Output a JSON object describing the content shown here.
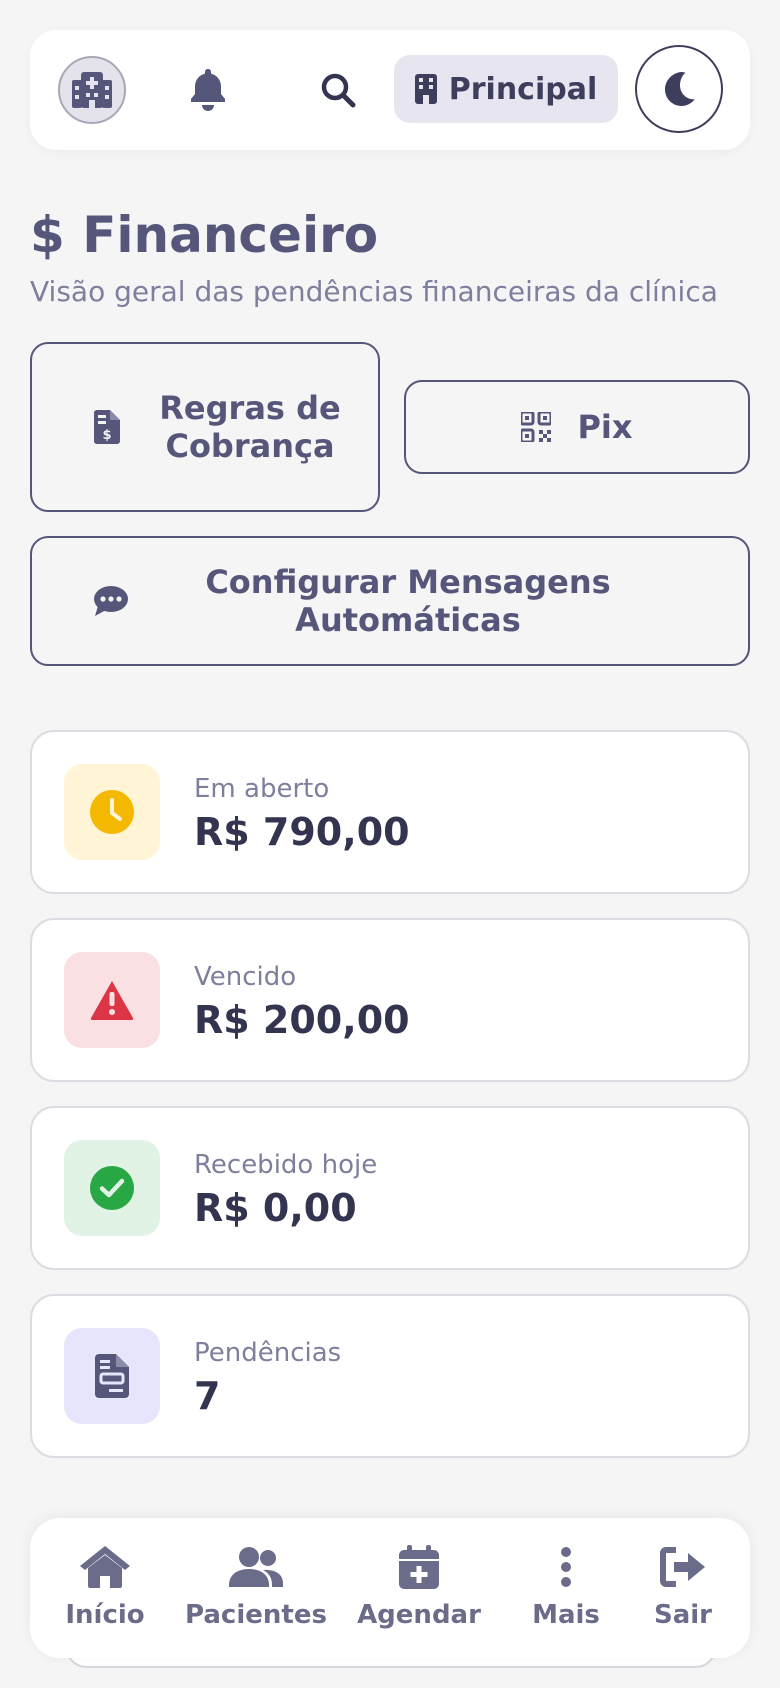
{
  "topbar": {
    "unit_label": "Principal"
  },
  "header": {
    "title": "$ Financeiro",
    "subtitle": "Visão geral das pendências financeiras da clínica"
  },
  "actions": {
    "rules_label": "Regras de Cobrança",
    "pix_label": "Pix",
    "messages_label": "Configurar Mensagens Automáticas"
  },
  "summary": [
    {
      "label": "Em aberto",
      "value": "R$ 790,00",
      "icon": "clock-icon",
      "bg": "#fff4d6",
      "color": "#f5b800"
    },
    {
      "label": "Vencido",
      "value": "R$ 200,00",
      "icon": "warning-icon",
      "bg": "#fbe0e3",
      "color": "#dc3545"
    },
    {
      "label": "Recebido hoje",
      "value": "R$ 0,00",
      "icon": "check-circle-icon",
      "bg": "#e1f3e5",
      "color": "#28a745"
    },
    {
      "label": "Pendências",
      "value": "7",
      "icon": "invoice-icon",
      "bg": "#e6e5fb",
      "color": "#555679"
    }
  ],
  "nav": [
    {
      "label": "Início",
      "icon": "home-icon"
    },
    {
      "label": "Pacientes",
      "icon": "users-icon"
    },
    {
      "label": "Agendar",
      "icon": "calendar-plus-icon"
    },
    {
      "label": "Mais",
      "icon": "more-vertical-icon"
    },
    {
      "label": "Sair",
      "icon": "logout-icon"
    }
  ],
  "colors": {
    "primary": "#555679",
    "background": "#f5f5f6",
    "surface": "#ffffff"
  }
}
